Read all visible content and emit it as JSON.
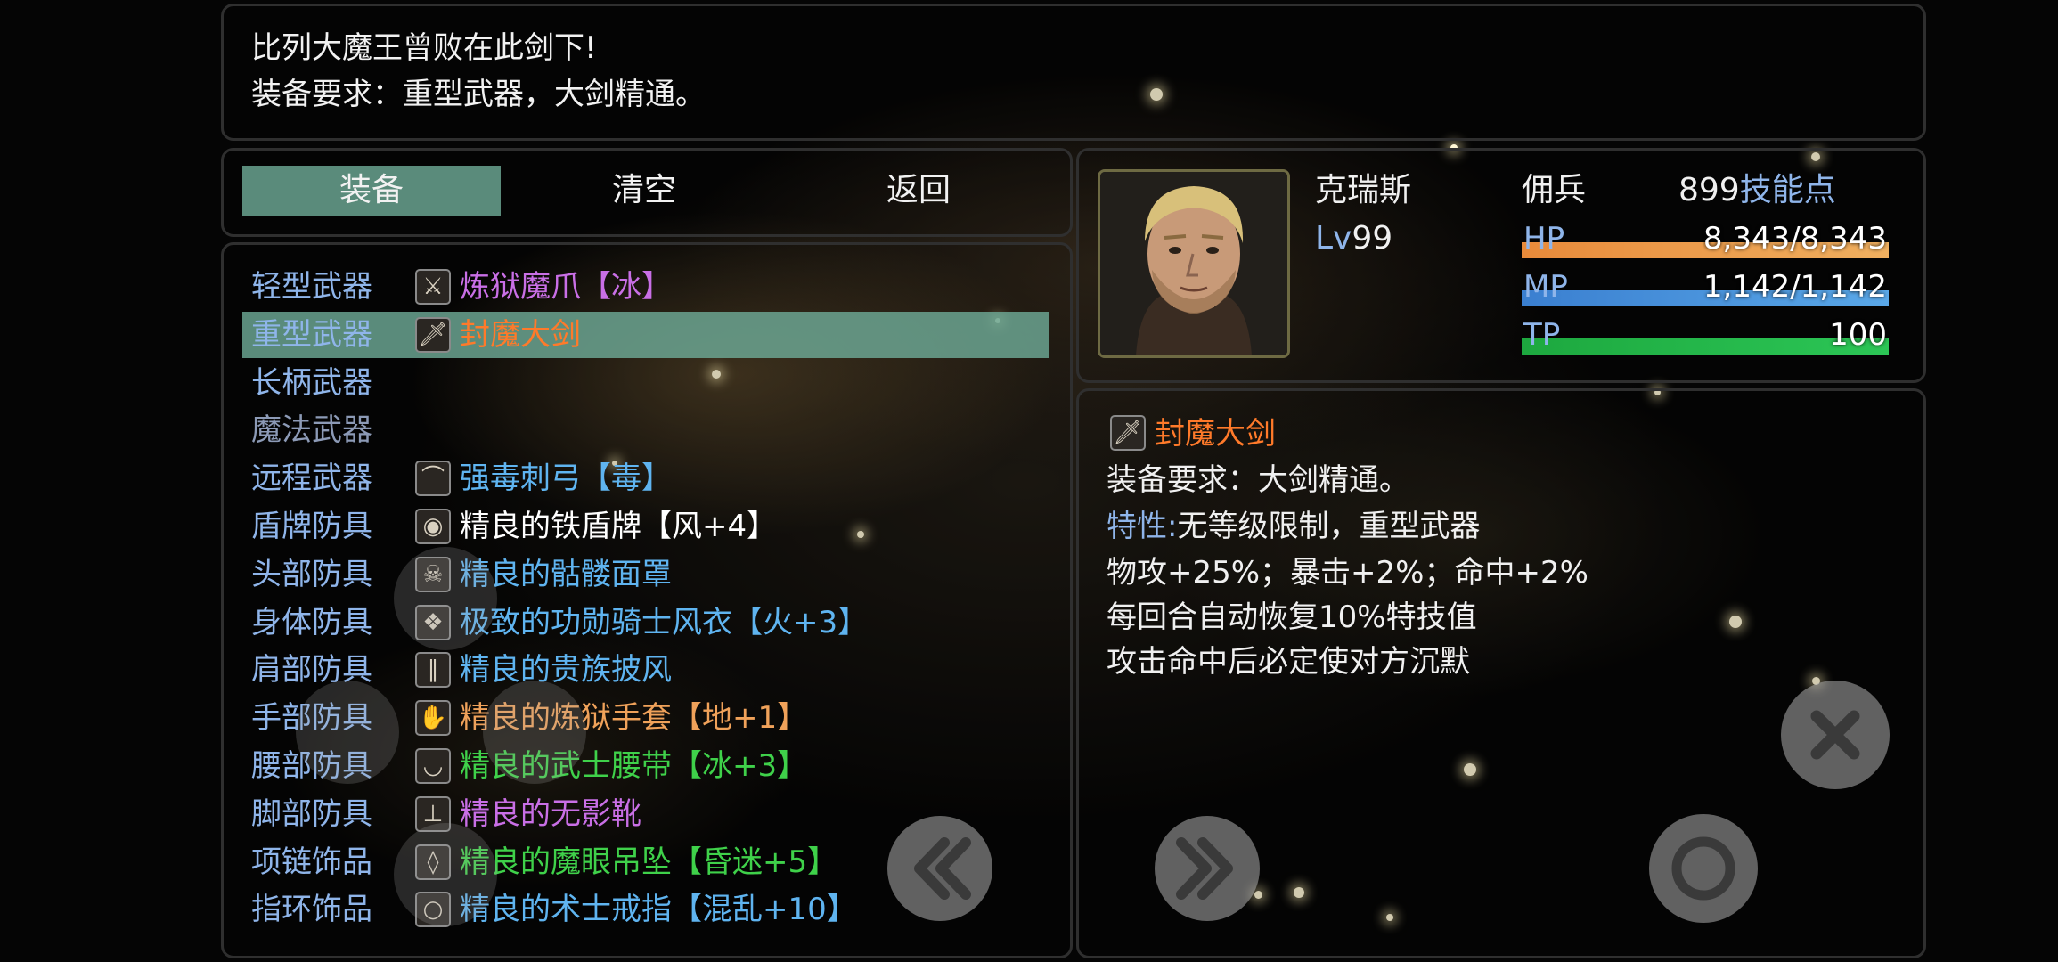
{
  "help": {
    "line1": "比列大魔王曾败在此剑下!",
    "line2": "装备要求：重型武器，大剑精通。"
  },
  "commands": [
    {
      "label": "装备",
      "selected": true
    },
    {
      "label": "清空",
      "selected": false
    },
    {
      "label": "返回",
      "selected": false
    }
  ],
  "slots": [
    {
      "label": "轻型武器",
      "item": "炼狱魔爪【冰】",
      "color": "#c96fe6",
      "icon": "claw-icon",
      "selected": false,
      "dim": false
    },
    {
      "label": "重型武器",
      "item": "封魔大剑",
      "color": "#ff7a2a",
      "icon": "sword-icon",
      "selected": true,
      "dim": false
    },
    {
      "label": "长柄武器",
      "item": "",
      "color": "#ffffff",
      "icon": "",
      "selected": false,
      "dim": false
    },
    {
      "label": "魔法武器",
      "item": "",
      "color": "#ffffff",
      "icon": "",
      "selected": false,
      "dim": true
    },
    {
      "label": "远程武器",
      "item": "强毒刺弓【毒】",
      "color": "#5fb4f0",
      "icon": "bow-icon",
      "selected": false,
      "dim": false
    },
    {
      "label": "盾牌防具",
      "item": "精良的铁盾牌【风+4】",
      "color": "#ffffff",
      "icon": "shield-icon",
      "selected": false,
      "dim": false
    },
    {
      "label": "头部防具",
      "item": "精良的骷髅面罩",
      "color": "#5fb4f0",
      "icon": "mask-icon",
      "selected": false,
      "dim": false
    },
    {
      "label": "身体防具",
      "item": "极致的功勋骑士风衣【火+3】",
      "color": "#5fb4f0",
      "icon": "coat-icon",
      "selected": false,
      "dim": false
    },
    {
      "label": "肩部防具",
      "item": "精良的贵族披风",
      "color": "#5fb4f0",
      "icon": "cape-icon",
      "selected": false,
      "dim": false
    },
    {
      "label": "手部防具",
      "item": "精良的炼狱手套【地+1】",
      "color": "#f0a25a",
      "icon": "glove-icon",
      "selected": false,
      "dim": false
    },
    {
      "label": "腰部防具",
      "item": "精良的武士腰带【冰+3】",
      "color": "#3fd14a",
      "icon": "belt-icon",
      "selected": false,
      "dim": false
    },
    {
      "label": "脚部防具",
      "item": "精良的无影靴",
      "color": "#c96fe6",
      "icon": "boot-icon",
      "selected": false,
      "dim": false
    },
    {
      "label": "项链饰品",
      "item": "精良的魔眼吊坠【昏迷+5】",
      "color": "#3fd14a",
      "icon": "pendant-icon",
      "selected": false,
      "dim": false
    },
    {
      "label": "指环饰品",
      "item": "精良的术士戒指【混乱+10】",
      "color": "#5fb4f0",
      "icon": "ring-icon",
      "selected": false,
      "dim": false
    }
  ],
  "actor": {
    "name": "克瑞斯",
    "class": "佣兵",
    "level_label": "Lv",
    "level": "99",
    "skill_points": "899",
    "skill_points_label": "技能点",
    "hp_label": "HP",
    "hp": "8,343/8,343",
    "hp_ratio": 1.0,
    "mp_label": "MP",
    "mp": "1,142/1,142",
    "mp_ratio": 1.0,
    "tp_label": "TP",
    "tp": "100",
    "tp_ratio": 1.0
  },
  "detail": {
    "name": "封魔大剑",
    "name_color": "#ff7a2a",
    "requirement": "装备要求：大剑精通。",
    "trait_label": "特性:",
    "trait_text": "无等级限制，重型武器",
    "line3": "物攻+25%；暴击+2%；命中+2%",
    "line4": "每回合自动恢复10%特技值",
    "line5": "攻击命中后必定使对方沉默"
  },
  "colors": {
    "accent_select": "#6eaa96",
    "hp_gauge": "#e5893c",
    "mp_gauge": "#3f88d6",
    "tp_gauge": "#1fb544",
    "label_blue": "#8fb5ea"
  }
}
